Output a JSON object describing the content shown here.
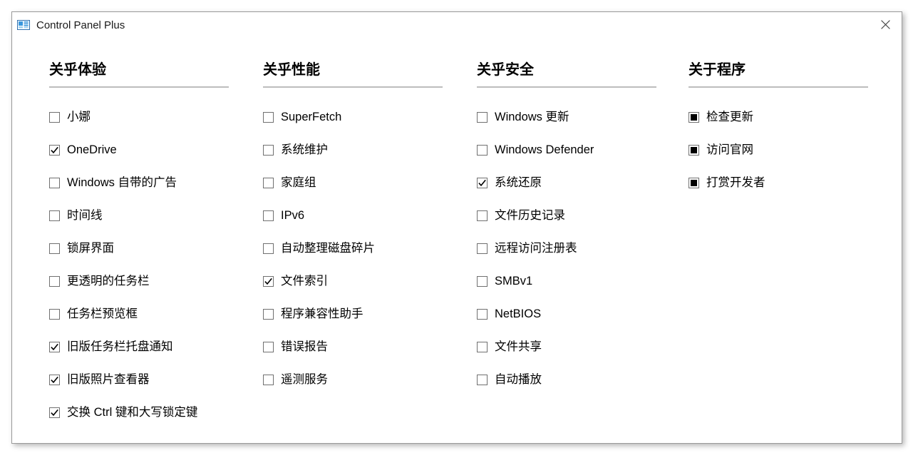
{
  "window": {
    "title": "Control Panel Plus",
    "app_icon": "control-panel-icon",
    "close_label": "✕"
  },
  "colors": {
    "window_border": "#9a9a9a",
    "divider": "#bdbdbd",
    "text": "#000000",
    "checkbox_border": "#707070",
    "checkbox_mark": "#000000",
    "icon_blue": "#1a7fd4"
  },
  "columns": [
    {
      "title": "关乎体验",
      "items": [
        {
          "label": "小娜",
          "state": "unchecked"
        },
        {
          "label": "OneDrive",
          "state": "checked"
        },
        {
          "label": "Windows 自带的广告",
          "state": "unchecked"
        },
        {
          "label": "时间线",
          "state": "unchecked"
        },
        {
          "label": "锁屏界面",
          "state": "unchecked"
        },
        {
          "label": "更透明的任务栏",
          "state": "unchecked"
        },
        {
          "label": "任务栏预览框",
          "state": "unchecked"
        },
        {
          "label": "旧版任务栏托盘通知",
          "state": "checked"
        },
        {
          "label": "旧版照片查看器",
          "state": "checked"
        },
        {
          "label": "交换 Ctrl 键和大写锁定键",
          "state": "checked"
        }
      ]
    },
    {
      "title": "关乎性能",
      "items": [
        {
          "label": "SuperFetch",
          "state": "unchecked"
        },
        {
          "label": "系统维护",
          "state": "unchecked"
        },
        {
          "label": "家庭组",
          "state": "unchecked"
        },
        {
          "label": "IPv6",
          "state": "unchecked"
        },
        {
          "label": "自动整理磁盘碎片",
          "state": "unchecked"
        },
        {
          "label": "文件索引",
          "state": "checked"
        },
        {
          "label": "程序兼容性助手",
          "state": "unchecked"
        },
        {
          "label": "错误报告",
          "state": "unchecked"
        },
        {
          "label": "遥测服务",
          "state": "unchecked"
        }
      ]
    },
    {
      "title": "关乎安全",
      "items": [
        {
          "label": "Windows 更新",
          "state": "unchecked"
        },
        {
          "label": "Windows Defender",
          "state": "unchecked"
        },
        {
          "label": "系统还原",
          "state": "checked"
        },
        {
          "label": "文件历史记录",
          "state": "unchecked"
        },
        {
          "label": "远程访问注册表",
          "state": "unchecked"
        },
        {
          "label": "SMBv1",
          "state": "unchecked"
        },
        {
          "label": "NetBIOS",
          "state": "unchecked"
        },
        {
          "label": "文件共享",
          "state": "unchecked"
        },
        {
          "label": "自动播放",
          "state": "unchecked"
        }
      ]
    },
    {
      "title": "关于程序",
      "items": [
        {
          "label": "检查更新",
          "state": "filled"
        },
        {
          "label": "访问官网",
          "state": "filled"
        },
        {
          "label": "打赏开发者",
          "state": "filled"
        }
      ]
    }
  ]
}
